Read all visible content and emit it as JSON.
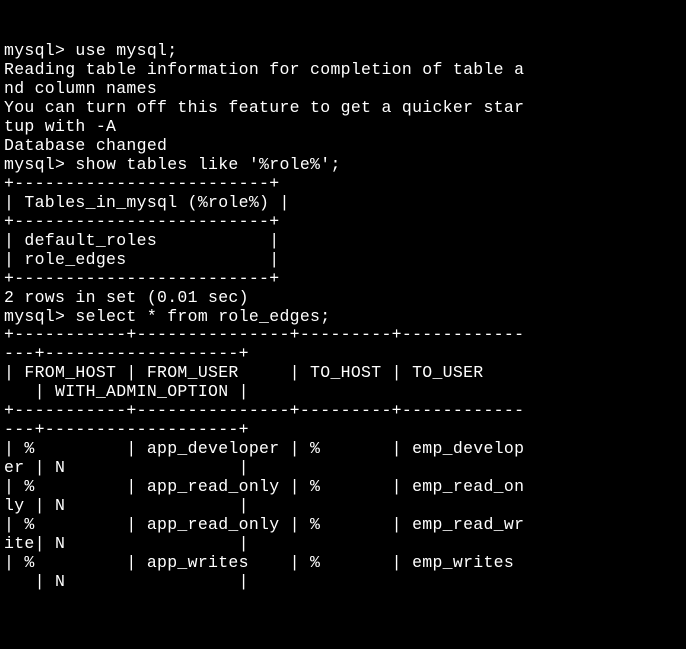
{
  "terminal": {
    "lines": [
      "mysql> use mysql;",
      "Reading table information for completion of table a",
      "nd column names",
      "You can turn off this feature to get a quicker star",
      "tup with -A",
      "",
      "Database changed",
      "mysql> show tables like '%role%';",
      "+-------------------------+",
      "| Tables_in_mysql (%role%) |",
      "+-------------------------+",
      "| default_roles           |",
      "| role_edges              |",
      "+-------------------------+",
      "2 rows in set (0.01 sec)",
      "",
      "mysql> select * from role_edges;",
      "+-----------+---------------+---------+------------",
      "---+-------------------+",
      "| FROM_HOST | FROM_USER     | TO_HOST | TO_USER    ",
      "   | WITH_ADMIN_OPTION |",
      "+-----------+---------------+---------+------------",
      "---+-------------------+",
      "| %         | app_developer | %       | emp_develop",
      "er | N                 |",
      "| %         | app_read_only | %       | emp_read_on",
      "ly | N                 |",
      "| %         | app_read_only | %       | emp_read_wr",
      "ite| N                 |",
      "| %         | app_writes    | %       | emp_writes ",
      "   | N                 |"
    ]
  }
}
